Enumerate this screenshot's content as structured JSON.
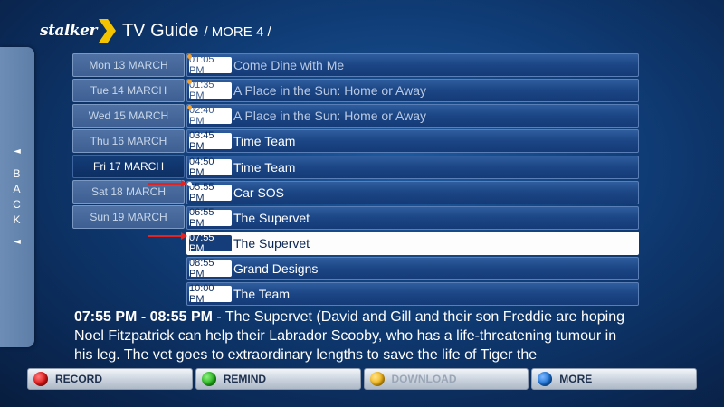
{
  "header": {
    "logo_text": "stalker",
    "title": "TV Guide",
    "crumb": "/ MORE 4 /"
  },
  "back": {
    "letters": [
      "B",
      "A",
      "C",
      "K"
    ],
    "arrow_glyph": "◄"
  },
  "days": [
    {
      "label": "Mon 13 MARCH",
      "active": false
    },
    {
      "label": "Tue 14 MARCH",
      "active": false
    },
    {
      "label": "Wed 15 MARCH",
      "active": false
    },
    {
      "label": "Thu 16 MARCH",
      "active": false
    },
    {
      "label": "Fri 17 MARCH",
      "active": true
    },
    {
      "label": "Sat 18 MARCH",
      "active": false
    },
    {
      "label": "Sun 19 MARCH",
      "active": false
    }
  ],
  "programs": [
    {
      "time": "01:05 PM",
      "title": "Come Dine with Me",
      "state": "past"
    },
    {
      "time": "01:35 PM",
      "title": "A Place in the Sun: Home or Away",
      "state": "past"
    },
    {
      "time": "02:40 PM",
      "title": "A Place in the Sun: Home or Away",
      "state": "past"
    },
    {
      "time": "03:45 PM",
      "title": "Time Team",
      "state": "normal"
    },
    {
      "time": "04:50 PM",
      "title": "Time Team",
      "state": "normal"
    },
    {
      "time": "05:55 PM",
      "title": "Car SOS",
      "state": "normal"
    },
    {
      "time": "06:55 PM",
      "title": "The Supervet",
      "state": "normal"
    },
    {
      "time": "07:55 PM",
      "title": "The Supervet",
      "state": "selected"
    },
    {
      "time": "08:55 PM",
      "title": "Grand Designs",
      "state": "normal"
    },
    {
      "time": "10:00 PM",
      "title": "The Team",
      "state": "normal"
    }
  ],
  "description": {
    "time_range": "07:55 PM - 08:55 PM",
    "text": " - The Supervet (David and Gill and their son Freddie are hoping Noel Fitzpatrick can help their Labrador Scooby, who has a life-threatening tumour in his leg. The vet goes to extraordinary lengths to save the life of Tiger the"
  },
  "buttons": [
    {
      "label": "RECORD",
      "color": "#e01818",
      "enabled": true
    },
    {
      "label": "REMIND",
      "color": "#27b51f",
      "enabled": true
    },
    {
      "label": "DOWNLOAD",
      "color": "#f2b51a",
      "enabled": false
    },
    {
      "label": "MORE",
      "color": "#1b72d6",
      "enabled": true
    }
  ],
  "colors": {
    "accent_yellow": "#f5c400",
    "arrow_red": "#e32222",
    "past_dot": "#f0a030"
  }
}
